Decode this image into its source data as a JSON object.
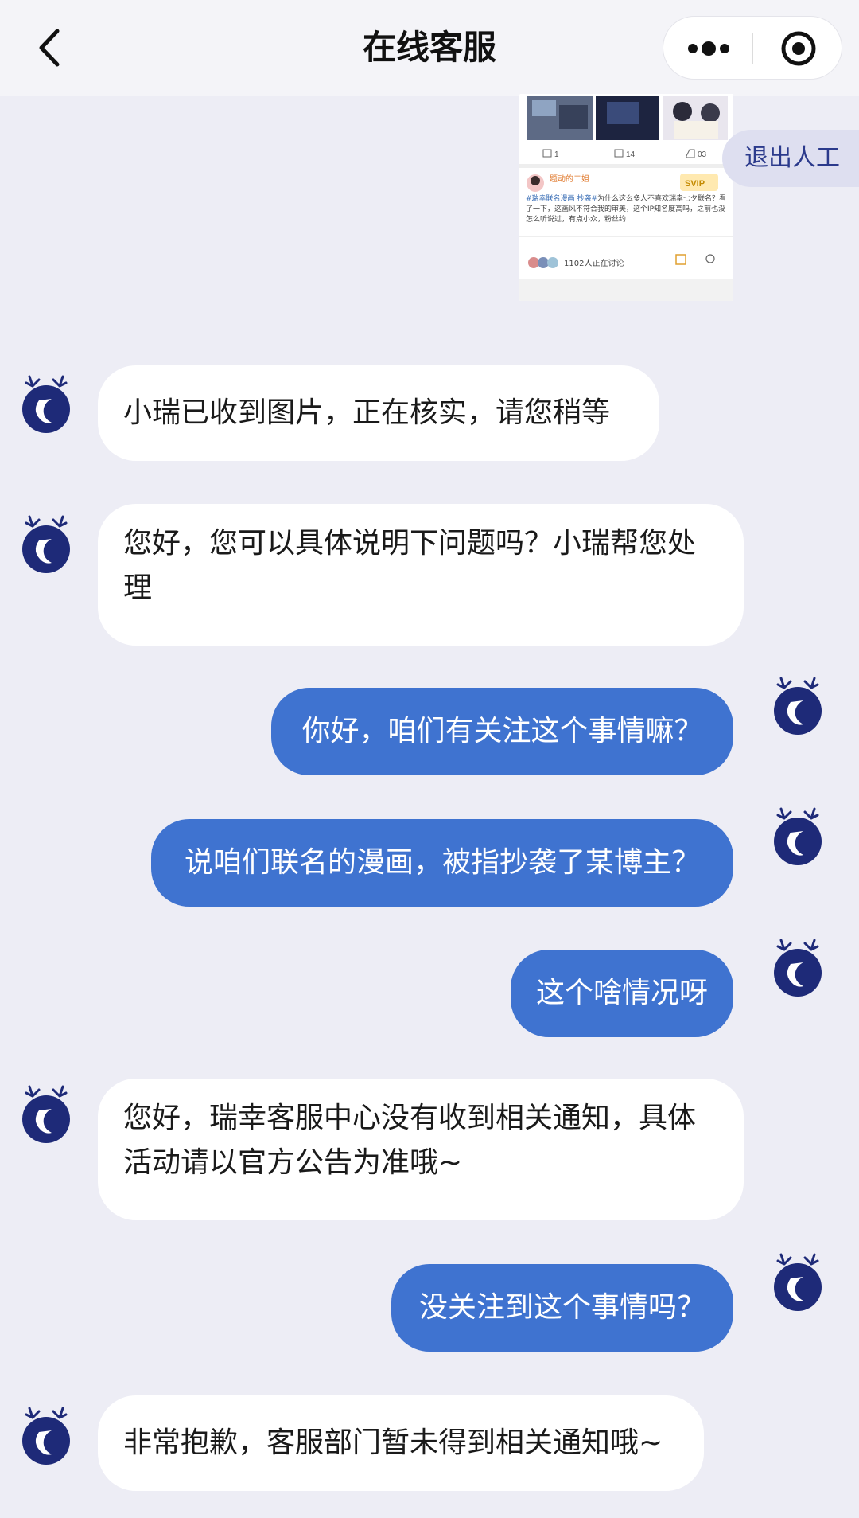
{
  "header": {
    "title": "在线客服"
  },
  "exit_button": "退出人工",
  "shared_image": {
    "counts": [
      "1",
      "14",
      "03"
    ],
    "post_user": "题动的二姐",
    "post_tag": "#瑞幸联名漫画 抄袭#",
    "post_text": "为什么这么多人不喜欢瑞幸七夕联名？看了一下，这画风不符合我的审美，这个IP知名度高吗，之前也没怎么听说过，有点小众，粉丝约",
    "discussion": "1102人正在讨论"
  },
  "messages": [
    {
      "side": "left",
      "text": "小瑞已收到图片，正在核实，请您稍等"
    },
    {
      "side": "left",
      "text": "您好，您可以具体说明下问题吗？小瑞帮您处理"
    },
    {
      "side": "right",
      "text": "你好，咱们有关注这个事情嘛？"
    },
    {
      "side": "right",
      "text": "说咱们联名的漫画，被指抄袭了某博主？"
    },
    {
      "side": "right",
      "text": "这个啥情况呀"
    },
    {
      "side": "left",
      "text": "您好，瑞幸客服中心没有收到相关通知，具体活动请以官方公告为准哦~"
    },
    {
      "side": "right",
      "text": "没关注到这个事情吗？"
    },
    {
      "side": "left",
      "text": "非常抱歉，客服部门暂未得到相关通知哦~"
    }
  ],
  "colors": {
    "background": "#ededf5",
    "user_bubble": "#3f73d0",
    "agent_bubble": "#ffffff",
    "brand_navy": "#1e2a78"
  },
  "icons": {
    "back": "chevron-left-icon",
    "more": "more-dots-icon",
    "close": "target-circle-icon",
    "avatar": "deer-logo-icon"
  }
}
